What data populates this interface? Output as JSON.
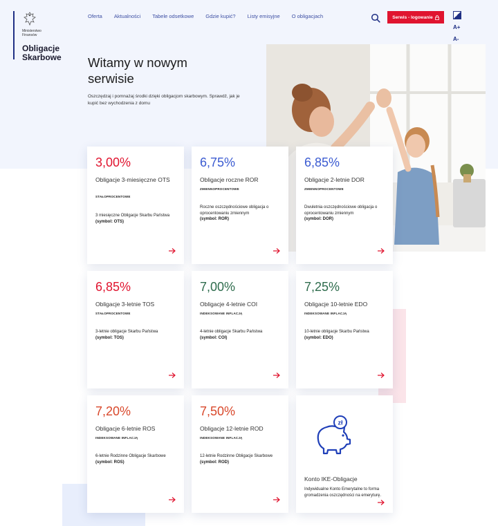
{
  "header": {
    "ministry": "Ministerstwo Finansów",
    "brand": "Obligacje Skarbowe",
    "nav": [
      "Oferta",
      "Aktualności",
      "Tabele odsetkowe",
      "Gdzie kupić?",
      "Listy emisyjne",
      "O obligacjach"
    ],
    "login_label": "Serwis - logowanie",
    "font_increase": "A+",
    "font_decrease": "A-"
  },
  "hero": {
    "title": "Witamy w nowym serwisie",
    "text": "Oszczędzaj i pomnażaj środki dzięki obligacjom skarbowym. Sprawdź, jak je kupić bez wychodzenia z domu"
  },
  "cards": [
    {
      "rate": "3,00%",
      "name": "Obligacje 3-miesięczne OTS",
      "type": "STAŁOPROCENTOWE",
      "desc": "3 miesięczne Obligacje Skarbu Państwa",
      "symbol": "(symbol: OTS)"
    },
    {
      "rate": "6,75%",
      "name": "Obligacje roczne ROR",
      "type": "ZMIENNOPROCENTOWE",
      "desc": "Roczne oszczędnościowe obligacja o oprocentowaniu zmiennym",
      "symbol": "(symbol: ROR)"
    },
    {
      "rate": "6,85%",
      "name": "Obligacje 2-letnie DOR",
      "type": "ZMIENNOPROCENTOWE",
      "desc": "Dwuletnia oszczędnościowe obligacja o oprocentowaniu zmiennym",
      "symbol": "(symbol: DOR)"
    },
    {
      "rate": "6,85%",
      "name": "Obligacje 3-letnie TOS",
      "type": "STAŁOPROCENTOWE",
      "desc": "3-letnie obligacje Skarbu Państwa",
      "symbol": "(symbol: TOS)"
    },
    {
      "rate": "7,00%",
      "name": "Obligacje 4-letnie COI",
      "type": "INDEKSOWANE INFLACJĄ",
      "desc": "4-letnie obligacje Skarbu Państwa",
      "symbol": "(symbol: COI)"
    },
    {
      "rate": "7,25%",
      "name": "Obligacje 10-letnie EDO",
      "type": "INDEKSOWANE INFLACJĄ",
      "desc": "10-letnie obligacje Skarbu Państwa",
      "symbol": "(symbol: EDO)"
    },
    {
      "rate": "7,20%",
      "name": "Obligacje 6-letnie ROS",
      "type": "INDEKSOWANE INFLACJĄ",
      "desc": "6-letnie Rodzinne Obligacje Skarbowe",
      "symbol": "(symbol: ROS)"
    },
    {
      "rate": "7,50%",
      "name": "Obligacje 12-letnie ROD",
      "type": "INDEKSOWANE INFLACJĄ",
      "desc": "12-letnie Rodzinne Obligacje Skarbowe",
      "symbol": "(symbol: ROD)"
    }
  ],
  "ike": {
    "title": "Konto IKE-Obligacje",
    "desc": "Indywidualne Konto Emerytalne to forma gromadzenia oszczędności na emeryturę.",
    "icon_text": "zł"
  },
  "colors": {
    "accent_red": "#e0142f",
    "navy": "#1f2f84",
    "link_blue": "#3d4fa3"
  }
}
